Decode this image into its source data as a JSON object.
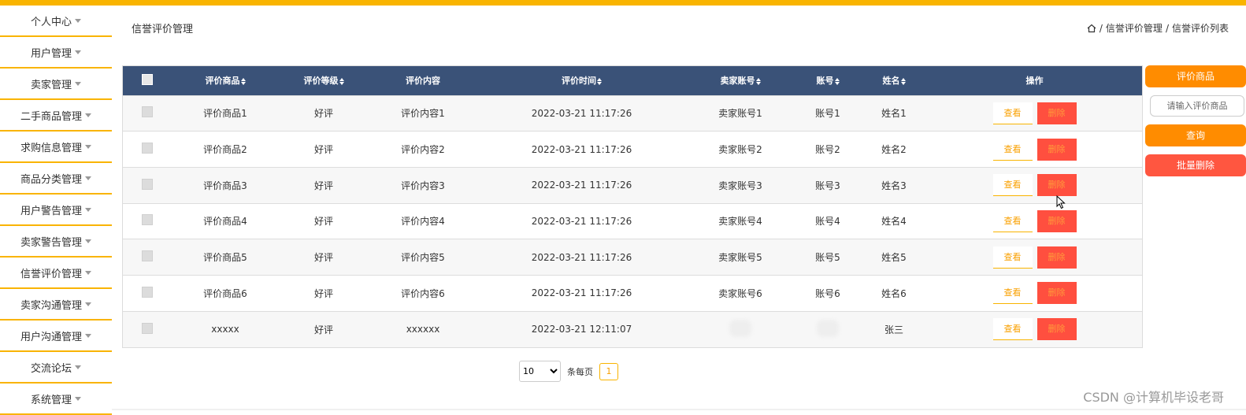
{
  "colors": {
    "accent": "#f9b400",
    "header_bg": "#3a5278",
    "orange": "#ff8c00",
    "red": "#ff5640"
  },
  "sidebar": {
    "items": [
      {
        "label": "个人中心"
      },
      {
        "label": "用户管理"
      },
      {
        "label": "卖家管理"
      },
      {
        "label": "二手商品管理"
      },
      {
        "label": "求购信息管理"
      },
      {
        "label": "商品分类管理"
      },
      {
        "label": "用户警告管理"
      },
      {
        "label": "卖家警告管理"
      },
      {
        "label": "信誉评价管理"
      },
      {
        "label": "卖家沟通管理"
      },
      {
        "label": "用户沟通管理"
      },
      {
        "label": "交流论坛"
      },
      {
        "label": "系统管理"
      }
    ]
  },
  "header": {
    "title": "信誉评价管理",
    "breadcrumb": [
      "信誉评价管理",
      "信誉评价列表"
    ],
    "separator": "/"
  },
  "table": {
    "columns": [
      "评价商品",
      "评价等级",
      "评价内容",
      "评价时间",
      "卖家账号",
      "账号",
      "姓名",
      "操作"
    ],
    "view_label": "查看",
    "delete_label": "删除",
    "rows": [
      {
        "product": "评价商品1",
        "level": "好评",
        "content": "评价内容1",
        "time": "2022-03-21 11:17:26",
        "seller": "卖家账号1",
        "account": "账号1",
        "name": "姓名1"
      },
      {
        "product": "评价商品2",
        "level": "好评",
        "content": "评价内容2",
        "time": "2022-03-21 11:17:26",
        "seller": "卖家账号2",
        "account": "账号2",
        "name": "姓名2"
      },
      {
        "product": "评价商品3",
        "level": "好评",
        "content": "评价内容3",
        "time": "2022-03-21 11:17:26",
        "seller": "卖家账号3",
        "account": "账号3",
        "name": "姓名3"
      },
      {
        "product": "评价商品4",
        "level": "好评",
        "content": "评价内容4",
        "time": "2022-03-21 11:17:26",
        "seller": "卖家账号4",
        "account": "账号4",
        "name": "姓名4"
      },
      {
        "product": "评价商品5",
        "level": "好评",
        "content": "评价内容5",
        "time": "2022-03-21 11:17:26",
        "seller": "卖家账号5",
        "account": "账号5",
        "name": "姓名5"
      },
      {
        "product": "评价商品6",
        "level": "好评",
        "content": "评价内容6",
        "time": "2022-03-21 11:17:26",
        "seller": "卖家账号6",
        "account": "账号6",
        "name": "姓名6"
      },
      {
        "product": "xxxxx",
        "level": "好评",
        "content": "xxxxxx",
        "time": "2022-03-21 12:11:07",
        "seller": "",
        "account": "",
        "name": "张三",
        "blurred": true
      }
    ]
  },
  "right_panel": {
    "product_btn": "评价商品",
    "search_placeholder": "请输入评价商品",
    "query_btn": "查询",
    "batch_delete_btn": "批量删除"
  },
  "pagination": {
    "page_size": "10",
    "page_size_options": [
      "10"
    ],
    "per_page_label": "条每页",
    "current_page": "1"
  },
  "watermark": "CSDN @计算机毕设老哥"
}
